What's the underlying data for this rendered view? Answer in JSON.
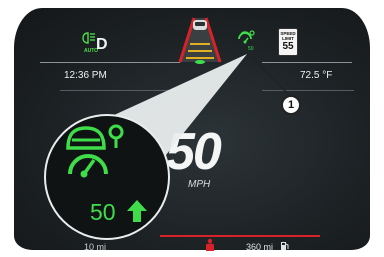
{
  "status_bar": {
    "headlight_auto_label": "AUTO",
    "gear": "D",
    "time": "12:36 PM",
    "outside_temp": "72.5 °F",
    "speed_limit_sign": {
      "line1": "SPEED",
      "line2": "LIMIT",
      "value": "55"
    }
  },
  "speedometer": {
    "speed_value": "50",
    "unit": "MPH"
  },
  "bottom_bar": {
    "odometer": "10 mi",
    "range": "360 mi"
  },
  "callout": {
    "set_speed": "50",
    "callout_number": "1"
  },
  "colors": {
    "indicator_green": "#3fdd4a",
    "alert_red": "#d8222a",
    "background": "#1d2225",
    "lane_amber": "#e0b020"
  },
  "icons": [
    "headlight-auto-icon",
    "adaptive-cruise-icon",
    "intelligent-speed-assist-icon",
    "speed-up-arrow-icon",
    "fuel-pump-icon",
    "seatbelt-warning-icon"
  ]
}
